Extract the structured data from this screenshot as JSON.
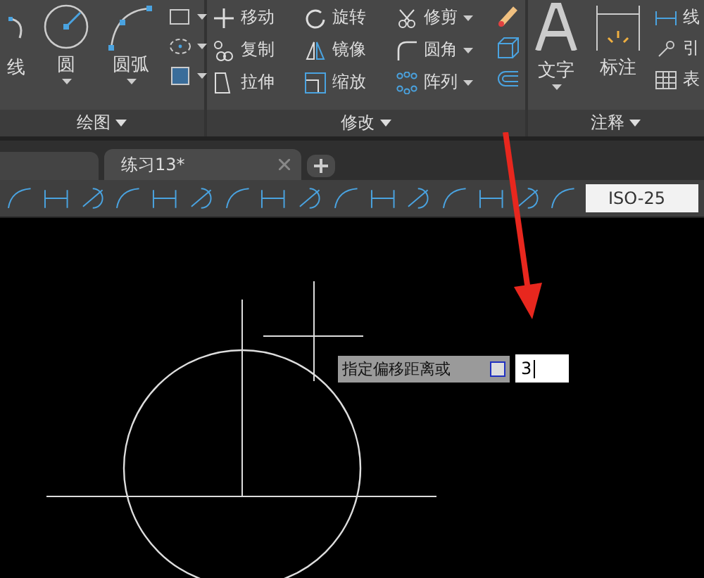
{
  "ribbon": {
    "panels": [
      {
        "label": "绘图",
        "large_tools": [
          {
            "label": "线",
            "kind": "polyline"
          },
          {
            "label": "圆",
            "kind": "circle"
          },
          {
            "label": "圆弧",
            "kind": "arc"
          }
        ],
        "small_tools": [
          {
            "kind": "rect"
          },
          {
            "kind": "ellipse"
          },
          {
            "kind": "hatch"
          }
        ]
      },
      {
        "label": "修改",
        "tools": [
          {
            "label": "移动",
            "kind": "move"
          },
          {
            "label": "旋转",
            "kind": "rotate"
          },
          {
            "label": "修剪",
            "kind": "trim"
          },
          {
            "label": "复制",
            "kind": "copy"
          },
          {
            "label": "镜像",
            "kind": "mirror"
          },
          {
            "label": "圆角",
            "kind": "fillet"
          },
          {
            "label": "拉伸",
            "kind": "stretch"
          },
          {
            "label": "缩放",
            "kind": "scale"
          },
          {
            "label": "阵列",
            "kind": "array"
          }
        ]
      },
      {
        "label": "注释",
        "large_tools": [
          {
            "label": "文字",
            "kind": "text"
          },
          {
            "label": "标注",
            "kind": "dim"
          }
        ],
        "small_tools": [
          {
            "label": "线",
            "kind": "linear"
          },
          {
            "label": "引",
            "kind": "leader"
          },
          {
            "label": "表",
            "kind": "table"
          }
        ]
      }
    ]
  },
  "document_tabs": [
    {
      "label": "练习13*",
      "selected": true
    }
  ],
  "dim_style": {
    "value": "ISO-25"
  },
  "command_prompt": {
    "label": "指定偏移距离或",
    "value": "3"
  }
}
